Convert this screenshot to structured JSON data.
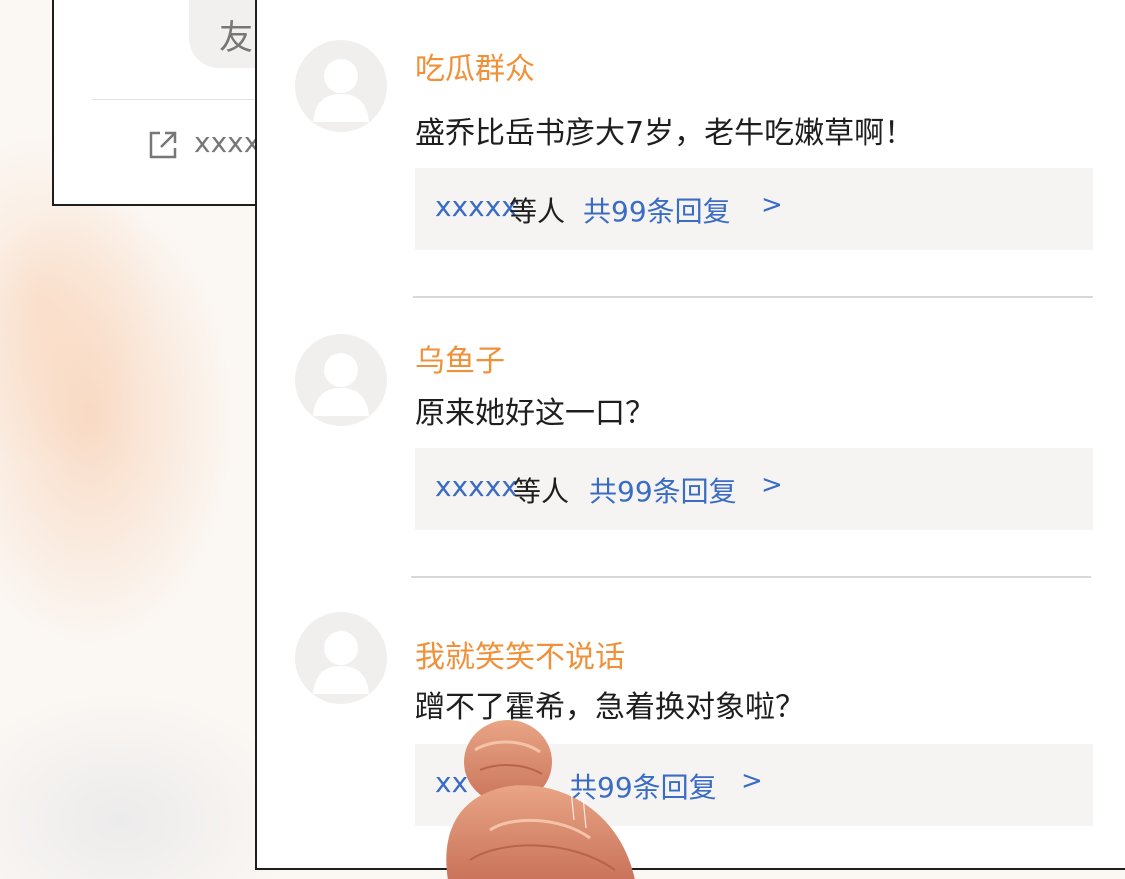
{
  "back_card": {
    "chip_text": "友",
    "share_text": "xxxx"
  },
  "comments": [
    {
      "username": "吃瓜群众",
      "text": "盛乔比岳书彦大7岁，老牛吃嫩草啊！",
      "reply_users": "xxxxx",
      "reply_suffix": "等人",
      "reply_count": "共99条回复",
      "reply_arrow": ">"
    },
    {
      "username": "乌鱼子",
      "text": "原来她好这一口？",
      "reply_users": "xxxxx",
      "reply_suffix": "等人",
      "reply_count": "共99条回复",
      "reply_arrow": ">"
    },
    {
      "username": "我就笑笑不说话",
      "text": "蹭不了霍希，急着换对象啦？",
      "reply_users": "xx",
      "reply_count": "共99条回复",
      "reply_arrow": ">"
    }
  ],
  "colors": {
    "username": "#f0913a",
    "link": "#3a6cc4",
    "reply_bg": "#f5f4f2"
  },
  "icons": {
    "avatar": "default-user-avatar-icon",
    "share": "external-link-icon"
  }
}
